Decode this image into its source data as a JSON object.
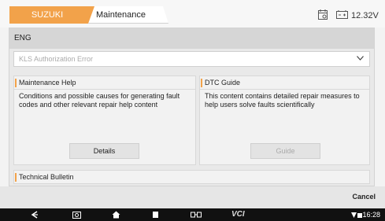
{
  "header": {
    "brand_tab": "SUZUKI",
    "active_tab": "Maintenance Guide",
    "voltage": "12.32V"
  },
  "language": {
    "value": "ENG"
  },
  "authorization_select": {
    "value": "KLS Authorization Error"
  },
  "cards": [
    {
      "title": "Maintenance Help",
      "description": "Conditions and possible causes for generating fault codes and other relevant repair help content",
      "button": "Details"
    },
    {
      "title": "DTC Guide",
      "description": "This content contains detailed repair measures to help users solve faults scientifically",
      "button": "Guide"
    }
  ],
  "bulletin": {
    "title": "Technical Bulletin"
  },
  "footer": {
    "cancel_label": "Cancel"
  },
  "system_bar": {
    "vci_label": "VCI",
    "time": "16:28"
  },
  "colors": {
    "accent": "#f2a24a"
  }
}
